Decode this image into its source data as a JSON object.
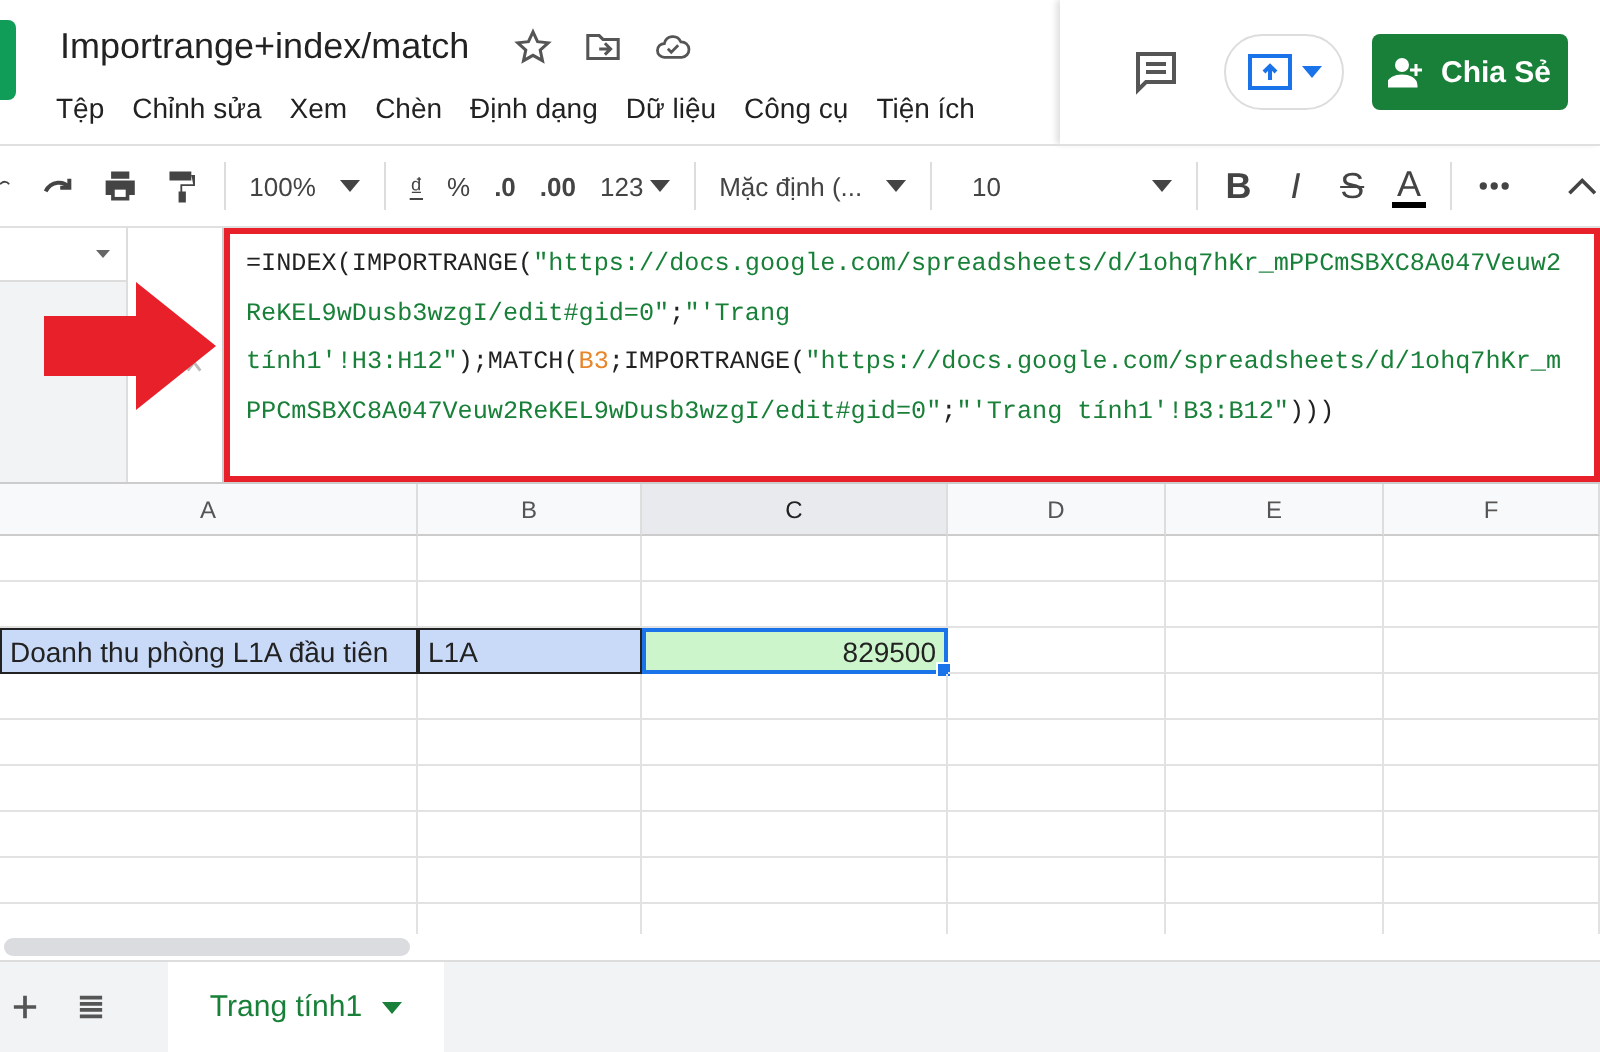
{
  "title": "Importrange+index/match",
  "menu": [
    "Tệp",
    "Chỉnh sửa",
    "Xem",
    "Chèn",
    "Định dạng",
    "Dữ liệu",
    "Công cụ",
    "Tiện ích"
  ],
  "share_button": "Chia Sẻ",
  "toolbar": {
    "zoom": "100%",
    "currency": "₫",
    "percent": "%",
    "decrease_decimals": ".0",
    "increase_decimals": ".00",
    "format": "123",
    "font": "Mặc định (...",
    "font_size": "10",
    "bold": "B",
    "italic": "I",
    "strikethrough": "S",
    "text_color": "A"
  },
  "formula_bar": {
    "lines": [
      [
        {
          "kind": "plain",
          "text": "=INDEX(IMPORTRANGE("
        },
        {
          "kind": "string",
          "text": "\"https://docs.google.com/spreadsheets/d/1ohq7hKr_mPPCmSBXC8A047Veuw2"
        }
      ],
      [
        {
          "kind": "string",
          "text": "ReKEL9wDusb3wzgI/edit#gid=0\""
        },
        {
          "kind": "plain",
          "text": ";"
        },
        {
          "kind": "string",
          "text": "\"'Trang"
        }
      ],
      [
        {
          "kind": "string",
          "text": "tính1'!H3:H12\""
        },
        {
          "kind": "plain",
          "text": ");MATCH("
        },
        {
          "kind": "ref",
          "text": "B3"
        },
        {
          "kind": "plain",
          "text": ";IMPORTRANGE("
        },
        {
          "kind": "string",
          "text": "\"https://docs.google.com/spreadsheets/d/1ohq7hKr_m"
        }
      ],
      [
        {
          "kind": "string",
          "text": "PPCmSBXC8A047Veuw2ReKEL9wDusb3wzgI/edit#gid=0\""
        },
        {
          "kind": "plain",
          "text": ";"
        },
        {
          "kind": "string",
          "text": "\"'Trang tính1'!B3:B12\""
        },
        {
          "kind": "plain",
          "text": ")))"
        }
      ]
    ]
  },
  "columns": [
    {
      "label": "A",
      "selected": false
    },
    {
      "label": "B",
      "selected": false
    },
    {
      "label": "C",
      "selected": true
    },
    {
      "label": "D",
      "selected": false
    },
    {
      "label": "E",
      "selected": false
    },
    {
      "label": "F",
      "selected": false
    }
  ],
  "rows": [
    {
      "cells": []
    },
    {
      "cells": []
    },
    {
      "cells": [
        {
          "text": "Doanh thu phòng L1A đầu tiên",
          "kind": "text",
          "color": "#c9daf8",
          "selected": false
        },
        {
          "text": "L1A",
          "kind": "text",
          "color": "#c9daf8",
          "selected": false
        },
        {
          "text": "829500",
          "kind": "number",
          "color": "#ccf5cc",
          "selected": true
        }
      ]
    },
    {
      "cells": []
    },
    {
      "cells": []
    },
    {
      "cells": []
    },
    {
      "cells": []
    },
    {
      "cells": []
    },
    {
      "cells": []
    }
  ],
  "sheet_tabs": [
    {
      "label": "Trang tính1",
      "selected": true
    }
  ]
}
